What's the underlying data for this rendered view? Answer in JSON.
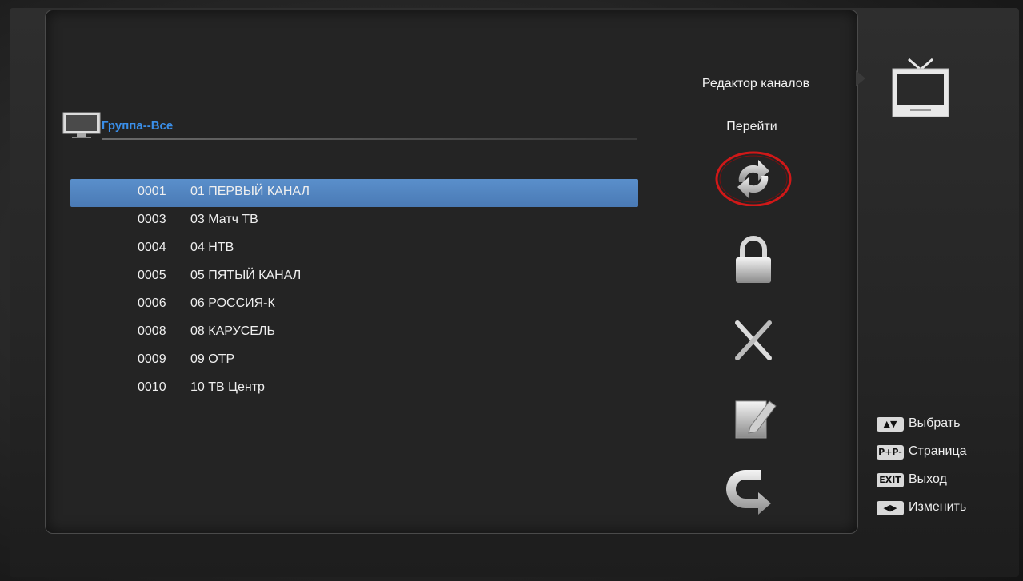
{
  "screen": {
    "title": "Редактор каналов",
    "group_label": "Группа--Все",
    "goto_label": "Перейти"
  },
  "channels": [
    {
      "num": "0001",
      "name": "01 ПЕРВЫЙ КАНАЛ",
      "selected": true
    },
    {
      "num": "0003",
      "name": "03 Матч ТВ",
      "selected": false
    },
    {
      "num": "0004",
      "name": "04 НТВ",
      "selected": false
    },
    {
      "num": "0005",
      "name": "05 ПЯТЫЙ КАНАЛ",
      "selected": false
    },
    {
      "num": "0006",
      "name": "06 РОССИЯ-К",
      "selected": false
    },
    {
      "num": "0008",
      "name": "08 КАРУСЕЛЬ",
      "selected": false
    },
    {
      "num": "0009",
      "name": "09 ОТР",
      "selected": false
    },
    {
      "num": "0010",
      "name": "10 ТВ Центр",
      "selected": false
    }
  ],
  "side_icons": [
    {
      "name": "move-icon",
      "active": true
    },
    {
      "name": "lock-icon",
      "active": false
    },
    {
      "name": "delete-icon",
      "active": false
    },
    {
      "name": "rename-icon",
      "active": false
    },
    {
      "name": "skip-icon",
      "active": false
    }
  ],
  "hints": [
    {
      "key": "▲▼",
      "label": "Выбрать"
    },
    {
      "key": "P+P-",
      "label": "Страница"
    },
    {
      "key": "EXIT",
      "label": "Выход"
    },
    {
      "key": "◀▶",
      "label": "Изменить"
    }
  ],
  "colors": {
    "selection": "#5a8fcb",
    "group_label": "#3a8ee8",
    "active_ring": "#d01818"
  }
}
